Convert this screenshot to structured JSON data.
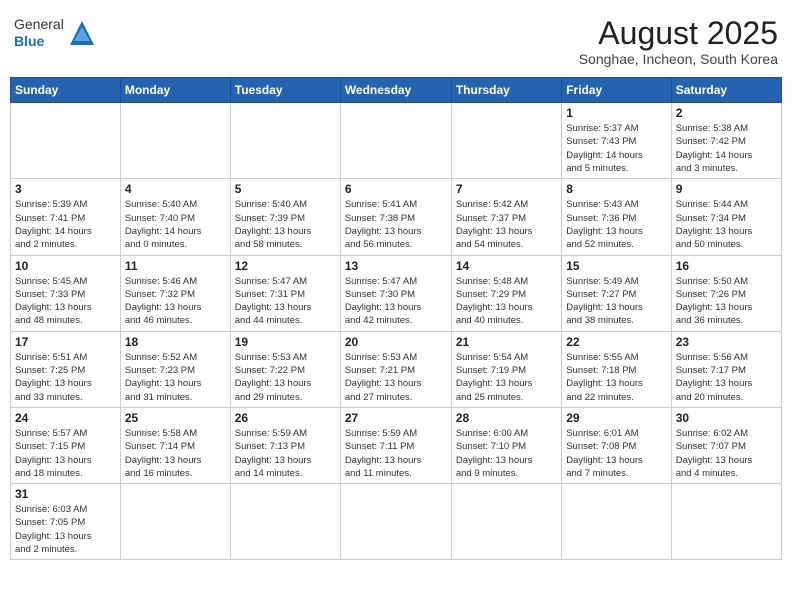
{
  "header": {
    "logo_line1": "General",
    "logo_line2": "Blue",
    "title": "August 2025",
    "subtitle": "Songhae, Incheon, South Korea"
  },
  "days_of_week": [
    "Sunday",
    "Monday",
    "Tuesday",
    "Wednesday",
    "Thursday",
    "Friday",
    "Saturday"
  ],
  "weeks": [
    [
      {
        "day": "",
        "info": ""
      },
      {
        "day": "",
        "info": ""
      },
      {
        "day": "",
        "info": ""
      },
      {
        "day": "",
        "info": ""
      },
      {
        "day": "",
        "info": ""
      },
      {
        "day": "1",
        "info": "Sunrise: 5:37 AM\nSunset: 7:43 PM\nDaylight: 14 hours\nand 5 minutes."
      },
      {
        "day": "2",
        "info": "Sunrise: 5:38 AM\nSunset: 7:42 PM\nDaylight: 14 hours\nand 3 minutes."
      }
    ],
    [
      {
        "day": "3",
        "info": "Sunrise: 5:39 AM\nSunset: 7:41 PM\nDaylight: 14 hours\nand 2 minutes."
      },
      {
        "day": "4",
        "info": "Sunrise: 5:40 AM\nSunset: 7:40 PM\nDaylight: 14 hours\nand 0 minutes."
      },
      {
        "day": "5",
        "info": "Sunrise: 5:40 AM\nSunset: 7:39 PM\nDaylight: 13 hours\nand 58 minutes."
      },
      {
        "day": "6",
        "info": "Sunrise: 5:41 AM\nSunset: 7:38 PM\nDaylight: 13 hours\nand 56 minutes."
      },
      {
        "day": "7",
        "info": "Sunrise: 5:42 AM\nSunset: 7:37 PM\nDaylight: 13 hours\nand 54 minutes."
      },
      {
        "day": "8",
        "info": "Sunrise: 5:43 AM\nSunset: 7:36 PM\nDaylight: 13 hours\nand 52 minutes."
      },
      {
        "day": "9",
        "info": "Sunrise: 5:44 AM\nSunset: 7:34 PM\nDaylight: 13 hours\nand 50 minutes."
      }
    ],
    [
      {
        "day": "10",
        "info": "Sunrise: 5:45 AM\nSunset: 7:33 PM\nDaylight: 13 hours\nand 48 minutes."
      },
      {
        "day": "11",
        "info": "Sunrise: 5:46 AM\nSunset: 7:32 PM\nDaylight: 13 hours\nand 46 minutes."
      },
      {
        "day": "12",
        "info": "Sunrise: 5:47 AM\nSunset: 7:31 PM\nDaylight: 13 hours\nand 44 minutes."
      },
      {
        "day": "13",
        "info": "Sunrise: 5:47 AM\nSunset: 7:30 PM\nDaylight: 13 hours\nand 42 minutes."
      },
      {
        "day": "14",
        "info": "Sunrise: 5:48 AM\nSunset: 7:29 PM\nDaylight: 13 hours\nand 40 minutes."
      },
      {
        "day": "15",
        "info": "Sunrise: 5:49 AM\nSunset: 7:27 PM\nDaylight: 13 hours\nand 38 minutes."
      },
      {
        "day": "16",
        "info": "Sunrise: 5:50 AM\nSunset: 7:26 PM\nDaylight: 13 hours\nand 36 minutes."
      }
    ],
    [
      {
        "day": "17",
        "info": "Sunrise: 5:51 AM\nSunset: 7:25 PM\nDaylight: 13 hours\nand 33 minutes."
      },
      {
        "day": "18",
        "info": "Sunrise: 5:52 AM\nSunset: 7:23 PM\nDaylight: 13 hours\nand 31 minutes."
      },
      {
        "day": "19",
        "info": "Sunrise: 5:53 AM\nSunset: 7:22 PM\nDaylight: 13 hours\nand 29 minutes."
      },
      {
        "day": "20",
        "info": "Sunrise: 5:53 AM\nSunset: 7:21 PM\nDaylight: 13 hours\nand 27 minutes."
      },
      {
        "day": "21",
        "info": "Sunrise: 5:54 AM\nSunset: 7:19 PM\nDaylight: 13 hours\nand 25 minutes."
      },
      {
        "day": "22",
        "info": "Sunrise: 5:55 AM\nSunset: 7:18 PM\nDaylight: 13 hours\nand 22 minutes."
      },
      {
        "day": "23",
        "info": "Sunrise: 5:56 AM\nSunset: 7:17 PM\nDaylight: 13 hours\nand 20 minutes."
      }
    ],
    [
      {
        "day": "24",
        "info": "Sunrise: 5:57 AM\nSunset: 7:15 PM\nDaylight: 13 hours\nand 18 minutes."
      },
      {
        "day": "25",
        "info": "Sunrise: 5:58 AM\nSunset: 7:14 PM\nDaylight: 13 hours\nand 16 minutes."
      },
      {
        "day": "26",
        "info": "Sunrise: 5:59 AM\nSunset: 7:13 PM\nDaylight: 13 hours\nand 14 minutes."
      },
      {
        "day": "27",
        "info": "Sunrise: 5:59 AM\nSunset: 7:11 PM\nDaylight: 13 hours\nand 11 minutes."
      },
      {
        "day": "28",
        "info": "Sunrise: 6:00 AM\nSunset: 7:10 PM\nDaylight: 13 hours\nand 9 minutes."
      },
      {
        "day": "29",
        "info": "Sunrise: 6:01 AM\nSunset: 7:08 PM\nDaylight: 13 hours\nand 7 minutes."
      },
      {
        "day": "30",
        "info": "Sunrise: 6:02 AM\nSunset: 7:07 PM\nDaylight: 13 hours\nand 4 minutes."
      }
    ],
    [
      {
        "day": "31",
        "info": "Sunrise: 6:03 AM\nSunset: 7:05 PM\nDaylight: 13 hours\nand 2 minutes."
      },
      {
        "day": "",
        "info": ""
      },
      {
        "day": "",
        "info": ""
      },
      {
        "day": "",
        "info": ""
      },
      {
        "day": "",
        "info": ""
      },
      {
        "day": "",
        "info": ""
      },
      {
        "day": "",
        "info": ""
      }
    ]
  ]
}
